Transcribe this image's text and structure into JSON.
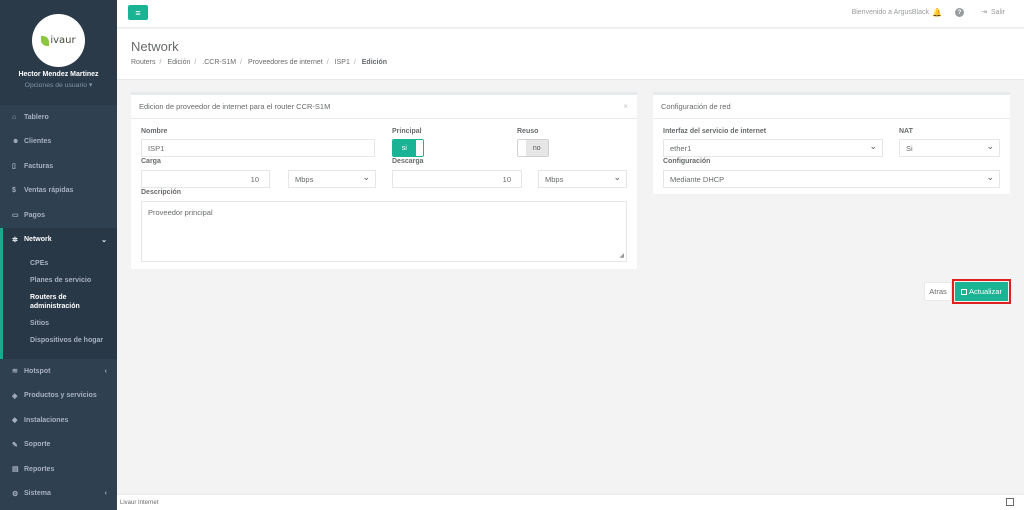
{
  "brand": {
    "logo_text": "ivaur"
  },
  "user": {
    "name": "Hector Mendez Martinez",
    "options": "Opciones de usuario ▾"
  },
  "sidebar": {
    "items": [
      {
        "icon": "⌂",
        "label": "Tablero"
      },
      {
        "icon": "☻",
        "label": "Clientes"
      },
      {
        "icon": "▯",
        "label": "Facturas"
      },
      {
        "icon": "$",
        "label": "Ventas rápidas"
      },
      {
        "icon": "▭",
        "label": "Pagos"
      },
      {
        "icon": "✲",
        "label": "Network",
        "chev": "⌄"
      },
      {
        "icon": "≋",
        "label": "Hotspot",
        "chev": "‹"
      },
      {
        "icon": "◈",
        "label": "Productos y servicios"
      },
      {
        "icon": "◆",
        "label": "Instalaciones"
      },
      {
        "icon": "✎",
        "label": "Soporte"
      },
      {
        "icon": "▤",
        "label": "Reportes"
      },
      {
        "icon": "⚙",
        "label": "Sistema",
        "chev": "‹"
      }
    ],
    "network_sub": [
      "CPEs",
      "Planes de servicio",
      "Routers de administración",
      "Sitios",
      "Dispositivos de hogar"
    ]
  },
  "topbar": {
    "menu_icon": "≡",
    "welcome": "Bienvenido a ArgusBlack",
    "bell": "🔔",
    "help": "?",
    "logout_icon": "⇥",
    "logout": "Salir"
  },
  "header": {
    "title": "Network",
    "breadcrumb": [
      "Routers",
      "Edición",
      ".CCR-S1M",
      "Proveedores de internet",
      "ISP1",
      "Edición"
    ]
  },
  "provider_panel": {
    "title": "Edicion de proveedor de internet para el router CCR-S1M",
    "close": "×",
    "nombre_label": "Nombre",
    "nombre_value": "ISP1",
    "principal_label": "Principal",
    "principal_value": "si",
    "reuso_label": "Reuso",
    "reuso_value": "no",
    "carga_label": "Carga",
    "carga_value": "10",
    "carga_unit": "Mbps",
    "descarga_label": "Descarga",
    "descarga_value": "10",
    "descarga_unit": "Mbps",
    "descripcion_label": "Descripción",
    "descripcion_value": "Proveedor principal",
    "resize": "◢"
  },
  "network_panel": {
    "title": "Configuración de red",
    "interfaz_label": "Interfaz del servicio de internet",
    "interfaz_value": "ether1",
    "nat_label": "NAT",
    "nat_value": "Si",
    "config_label": "Configuración",
    "config_value": "Mediante DHCP"
  },
  "actions": {
    "back": "Atras",
    "save": "Actualizar"
  },
  "footer": {
    "text": "Livaur Internet"
  },
  "colors": {
    "accent": "#1ab394",
    "sidebar": "#2f4050",
    "highlight": "#e02020"
  }
}
